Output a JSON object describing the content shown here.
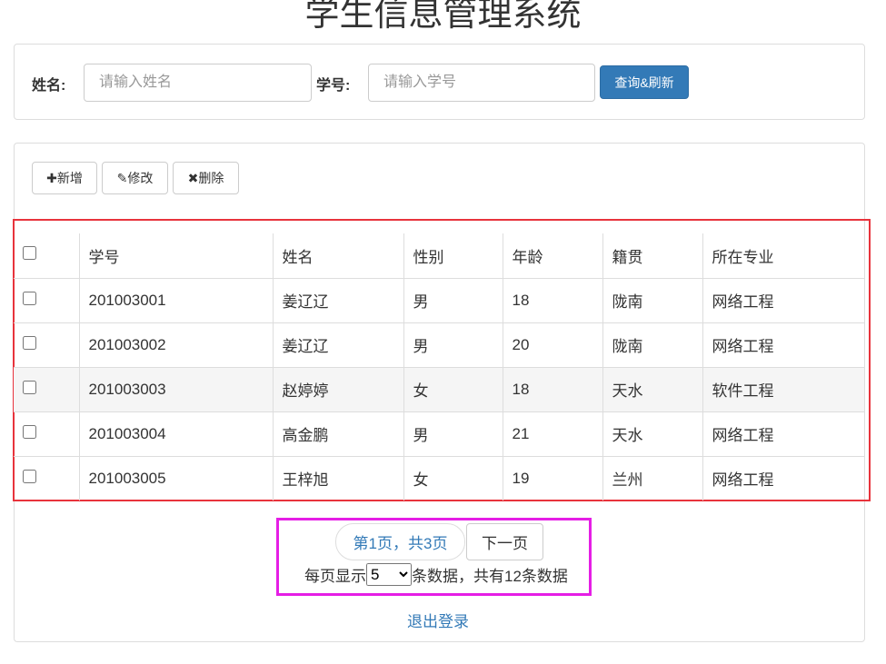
{
  "title": "学生信息管理系统",
  "search": {
    "name_label": "姓名:",
    "name_placeholder": "请输入姓名",
    "id_label": "学号:",
    "id_placeholder": "请输入学号",
    "query_button": "查询&刷新"
  },
  "toolbar": {
    "add": "新增",
    "edit": "修改",
    "delete": "删除",
    "add_icon": "✚",
    "edit_icon": "✎",
    "delete_icon": "✖"
  },
  "table": {
    "headers": [
      "学号",
      "姓名",
      "性别",
      "年龄",
      "籍贯",
      "所在专业"
    ],
    "rows": [
      [
        "201003001",
        "姜辽辽",
        "男",
        "18",
        "陇南",
        "网络工程"
      ],
      [
        "201003002",
        "姜辽辽",
        "男",
        "20",
        "陇南",
        "网络工程"
      ],
      [
        "201003003",
        "赵婷婷",
        "女",
        "18",
        "天水",
        "软件工程"
      ],
      [
        "201003004",
        "高金鹏",
        "男",
        "21",
        "天水",
        "网络工程"
      ],
      [
        "201003005",
        "王梓旭",
        "女",
        "19",
        "兰州",
        "网络工程"
      ]
    ]
  },
  "pagination": {
    "current": "第1页，共3页",
    "next": "下一页",
    "per_page_prefix": "每页显示",
    "per_page_value": "5",
    "per_page_suffix": "条数据，共有12条数据"
  },
  "logout": "退出登录"
}
